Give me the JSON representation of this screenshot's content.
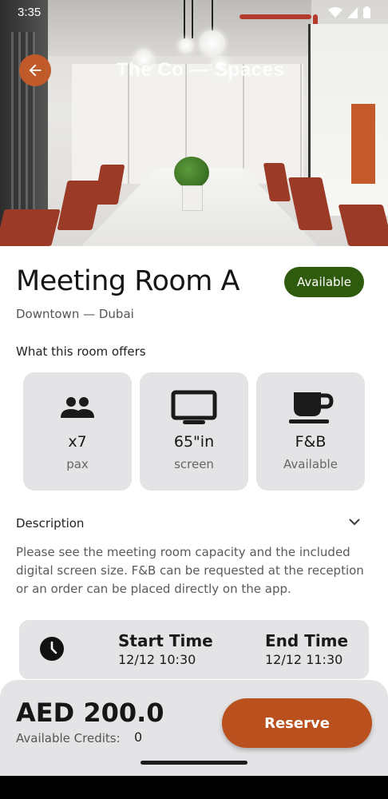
{
  "status_bar": {
    "time": "3:35"
  },
  "hero": {
    "brand_text": "The Co — Spaces"
  },
  "room": {
    "title": "Meeting Room A",
    "status": "Available",
    "location": "Downtown — Dubai"
  },
  "offers": {
    "title": "What this room offers",
    "items": [
      {
        "icon": "people-icon",
        "value": "x7",
        "sub": "pax"
      },
      {
        "icon": "monitor-icon",
        "value": "65\"in",
        "sub": "screen"
      },
      {
        "icon": "coffee-cup-icon",
        "value": "F&B",
        "sub": "Available"
      }
    ]
  },
  "description": {
    "title": "Description",
    "text": "Please see the meeting room capacity and the included digital screen size. F&B can be requested at the reception or an order can be placed directly on the app."
  },
  "schedule": {
    "start_label": "Start Time",
    "start_value": "12/12 10:30",
    "end_label": "End Time",
    "end_value": "12/12 11:30"
  },
  "checkout": {
    "price": "AED 200.0",
    "credits_label": "Available Credits:",
    "credits_value": "0",
    "reserve_label": "Reserve"
  },
  "colors": {
    "accent": "#B9501D",
    "available_badge": "#2E5B0E",
    "card_bg": "#E4E3E5"
  }
}
